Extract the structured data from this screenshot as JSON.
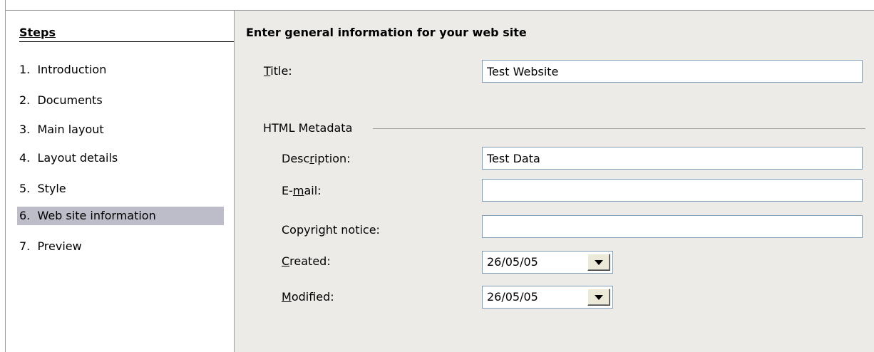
{
  "sidebar": {
    "heading": "Steps",
    "steps": [
      {
        "label": "1.  Introduction",
        "selected": false
      },
      {
        "label": "2.  Documents",
        "selected": false
      },
      {
        "label": "3.  Main layout",
        "selected": false
      },
      {
        "label": "4.  Layout details",
        "selected": false
      },
      {
        "label": "5.  Style",
        "selected": false
      },
      {
        "label": "6.  Web site information",
        "selected": true
      },
      {
        "label": "7.  Preview",
        "selected": false
      }
    ]
  },
  "main": {
    "title": "Enter general information for your web site",
    "title_field": {
      "label_mnemonic": "T",
      "label_rest": "itle:",
      "value": "Test Website"
    },
    "metadata_group": {
      "label": "HTML Metadata",
      "description": {
        "label_pre": "Desc",
        "label_mnemonic": "r",
        "label_post": "iption:",
        "value": "Test Data"
      },
      "email": {
        "label_pre": "E-",
        "label_mnemonic": "m",
        "label_post": "ail:",
        "value": ""
      },
      "copyright": {
        "label_pre": "Copyri",
        "label_mnemonic": "g",
        "label_post": "ht notice:",
        "value": ""
      },
      "created": {
        "label_pre": "",
        "label_mnemonic": "C",
        "label_post": "reated:",
        "value": "26/05/05"
      },
      "modified": {
        "label_pre": "",
        "label_mnemonic": "M",
        "label_post": "odified:",
        "value": "26/05/05"
      }
    }
  },
  "colors": {
    "panel_background": "#ecebe8",
    "selected_step": "#bdbdc9",
    "input_border": "#7f9db9"
  }
}
